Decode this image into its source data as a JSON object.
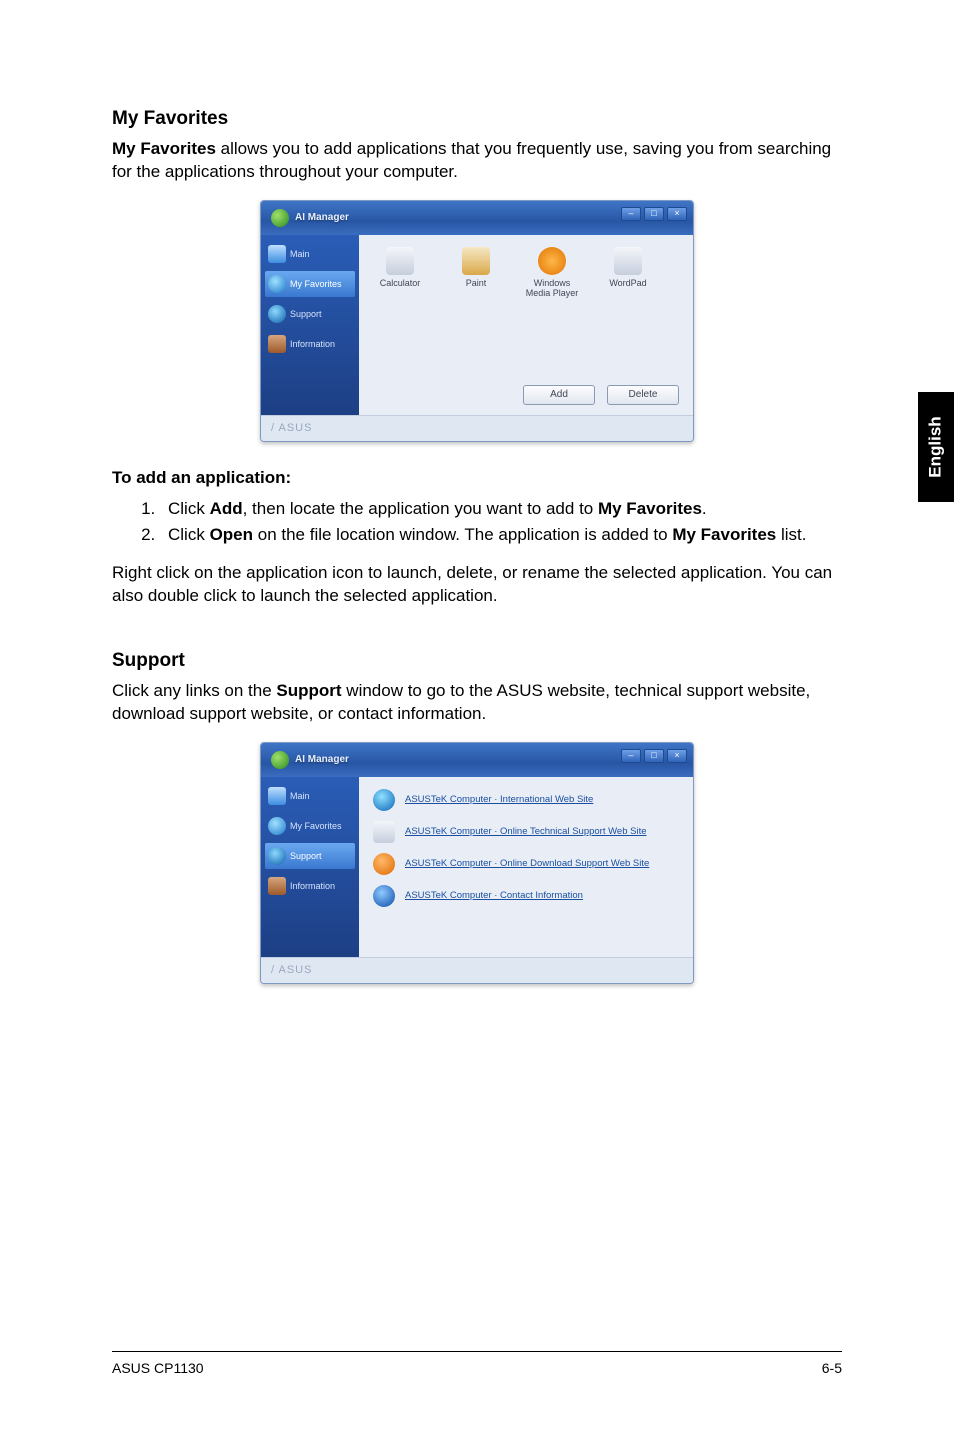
{
  "side_tab": "English",
  "sections": {
    "fav_heading": "My Favorites",
    "fav_intro_prefix_bold": "My Favorites",
    "fav_intro_rest": " allows you to add applications that you frequently use, saving you from searching for the applications throughout your computer.",
    "add_app_heading": "To add an application:",
    "step1_pre": "Click ",
    "step1_bold1": "Add",
    "step1_mid": ", then locate the application you want to add to ",
    "step1_bold2": "My Favorites",
    "step1_end": ".",
    "step2_pre": "Click ",
    "step2_bold1": "Open",
    "step2_mid": " on the file location window. The application is added to ",
    "step2_bold2": "My Favorites",
    "step2_end": " list.",
    "fav_outro": "Right click on the application icon to launch, delete, or rename the selected application. You can also double click to launch the selected application.",
    "sup_heading": "Support",
    "sup_intro_pre": "Click any links on the ",
    "sup_intro_bold": "Support",
    "sup_intro_post": " window to go to the ASUS website, technical support website, download support website, or contact information."
  },
  "footer": {
    "left": "ASUS CP1130",
    "right": "6-5"
  },
  "app": {
    "title": "AI Manager",
    "win_min": "–",
    "win_max": "□",
    "win_close": "×",
    "footer_brand": "/ ASUS",
    "sidebar": {
      "main": "Main",
      "fav": "My Favorites",
      "sup": "Support",
      "info": "Information"
    },
    "favorites": {
      "calc": "Calculator",
      "paint": "Paint",
      "wmp": "Windows Media Player",
      "wordpad": "WordPad",
      "btn_add": "Add",
      "btn_delete": "Delete"
    },
    "support_links": {
      "l1": "ASUSTeK Computer · International Web Site",
      "l2": "ASUSTeK Computer · Online Technical Support Web Site",
      "l3": "ASUSTeK Computer · Online Download Support Web Site",
      "l4": "ASUSTeK Computer · Contact Information"
    }
  }
}
